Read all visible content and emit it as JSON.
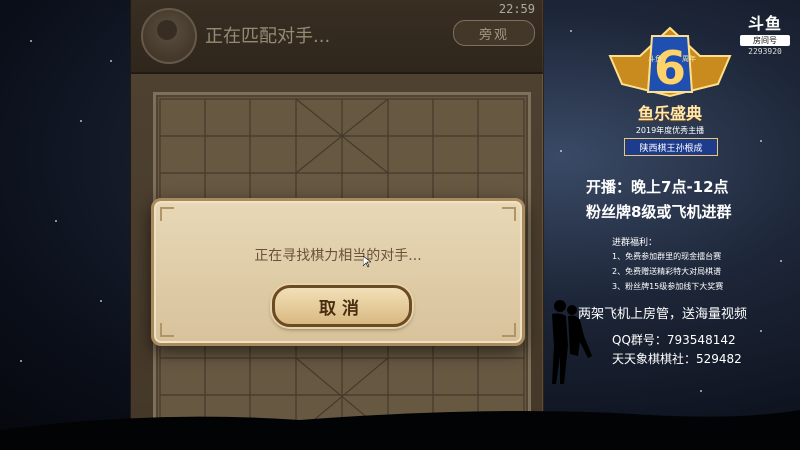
{
  "game": {
    "status_text": "正在匹配对手...",
    "clock": "22:59",
    "watch_button": "旁观"
  },
  "modal": {
    "message": "正在寻找棋力相当的对手...",
    "cancel_button": "取消"
  },
  "stream_logo": {
    "brand": "斗鱼",
    "sub": "房间号",
    "room_id": "2293920"
  },
  "badge": {
    "number": "6",
    "left_small": "斗鱼",
    "right_small": "周年",
    "title": "鱼乐盛典",
    "year_text": "2019年度优秀主播",
    "streamer": "陕西棋王孙根成"
  },
  "promo": {
    "line1": "开播：晚上7点-12点",
    "line2": "粉丝牌8级或飞机进群",
    "perks_title": "进群福利：",
    "perks": [
      "1、免费参加群里的现金擂台赛",
      "2、免费赠送精彩特大对局棋谱",
      "3、粉丝牌15级参加线下大奖赛"
    ],
    "slogan": "两架飞机上房管，送海量视频",
    "qq_group": "QQ群号：793548142",
    "chess_club": "天天象棋棋社：529482"
  }
}
